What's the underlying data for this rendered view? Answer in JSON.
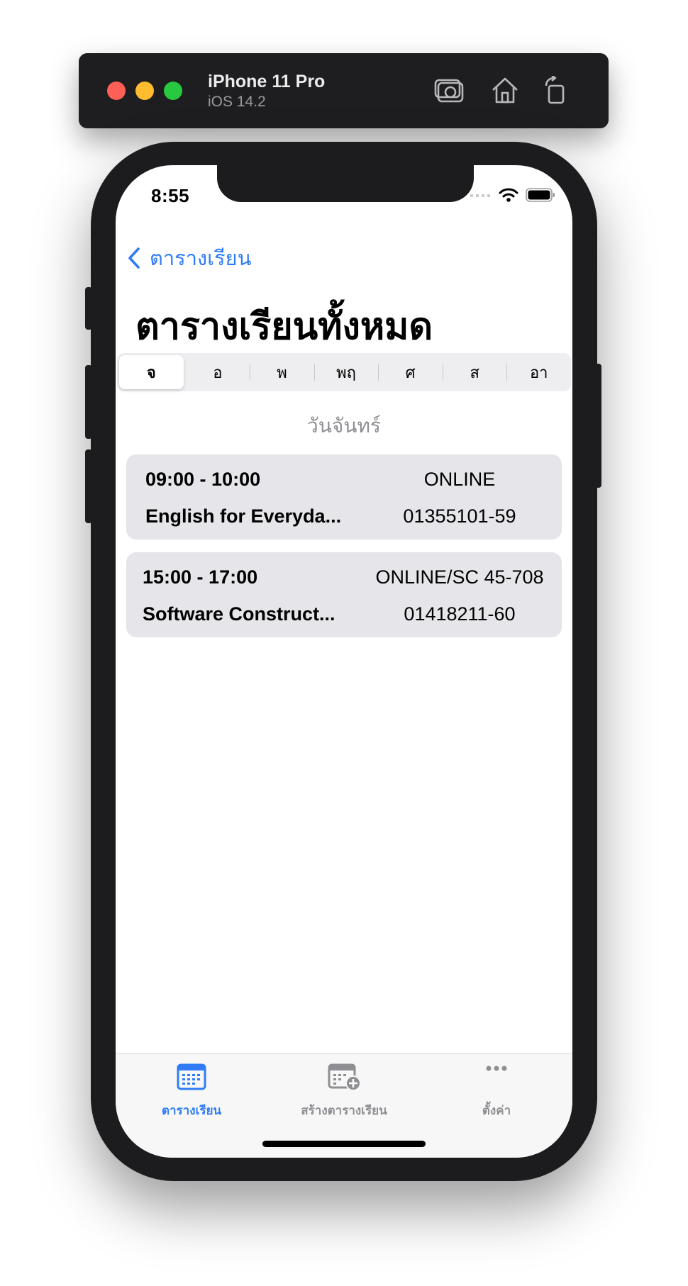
{
  "simulator": {
    "device_name": "iPhone 11 Pro",
    "os_version": "iOS 14.2",
    "icons": [
      "screenshot-icon",
      "home-icon",
      "rotate-icon"
    ]
  },
  "status_bar": {
    "time": "8:55"
  },
  "nav": {
    "back_label": "ตารางเรียน"
  },
  "page": {
    "title": "ตารางเรียนทั้งหมด"
  },
  "day_picker": {
    "segments": [
      "จ",
      "อ",
      "พ",
      "พฤ",
      "ศ",
      "ส",
      "อา"
    ],
    "selected": "จ"
  },
  "day_heading": "วันจันทร์",
  "courses": [
    {
      "time": "09:00 - 10:00",
      "room": "ONLINE",
      "name": "English for Everyda...",
      "code": "01355101-59"
    },
    {
      "time": "15:00 - 17:00",
      "room": "ONLINE/SC 45-708",
      "name": "Software Construct...",
      "code": "01418211-60"
    }
  ],
  "tab_bar": {
    "items": [
      {
        "label": "ตารางเรียน",
        "icon": "calendar-icon",
        "active": true
      },
      {
        "label": "สร้างตารางเรียน",
        "icon": "calendar-add-icon",
        "active": false
      },
      {
        "label": "ตั้งค่า",
        "icon": "more-icon",
        "active": false
      }
    ]
  },
  "colors": {
    "accent": "#2f7cf6",
    "card_background": "#e5e5ea",
    "secondary_text": "#8e8e93"
  }
}
